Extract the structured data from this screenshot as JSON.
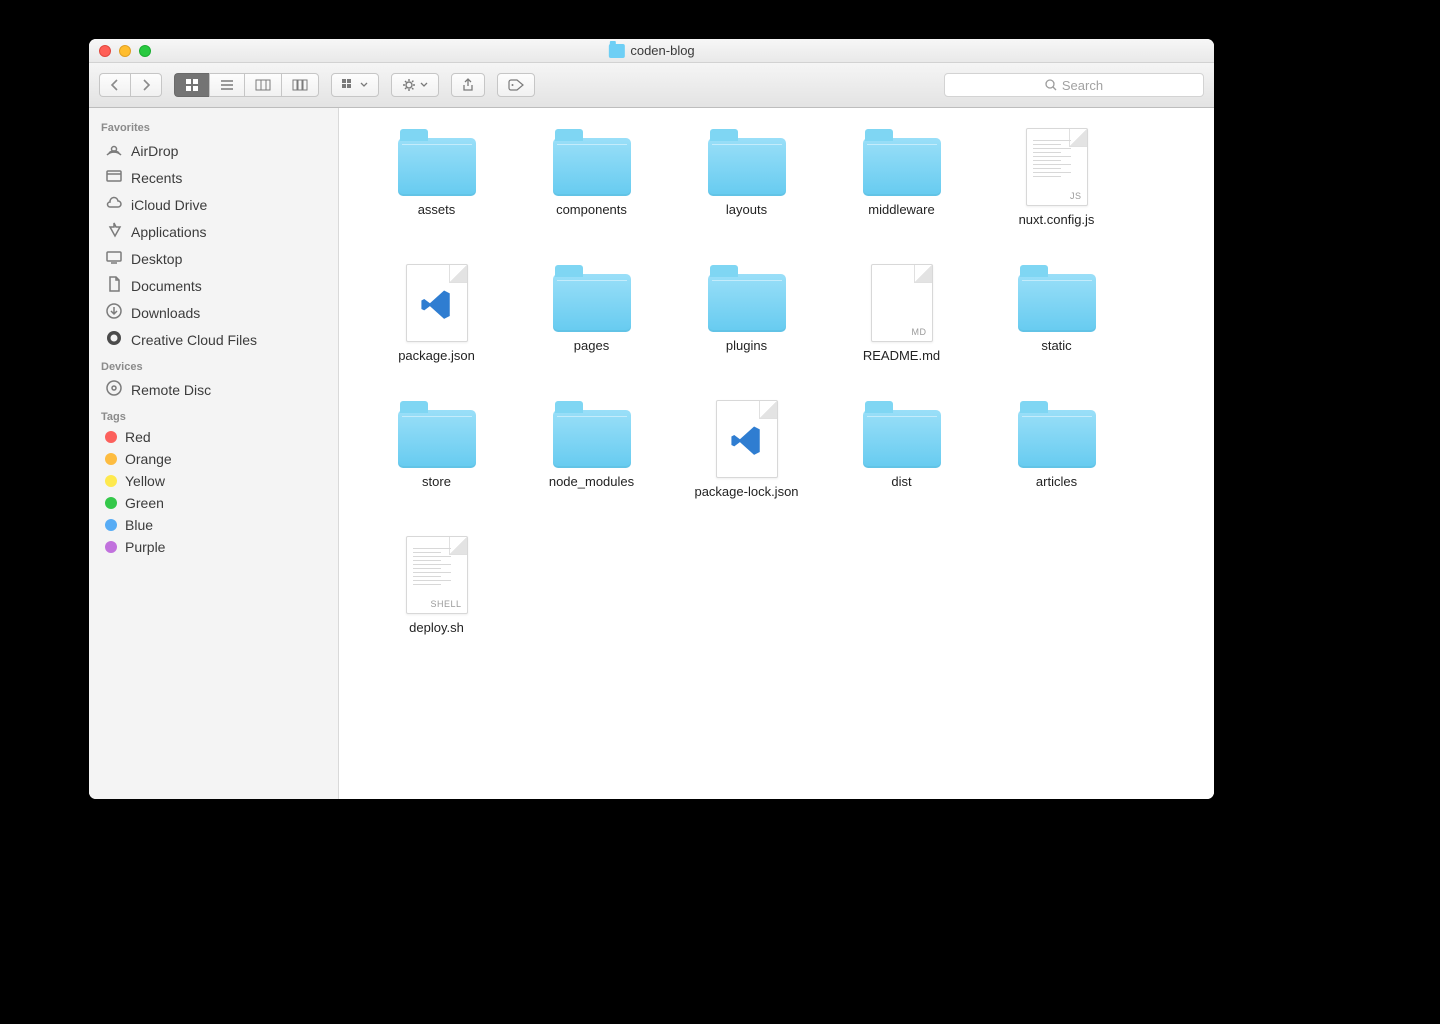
{
  "window": {
    "title": "coden-blog"
  },
  "search": {
    "placeholder": "Search"
  },
  "sidebar": {
    "groups": [
      {
        "title": "Favorites",
        "items": [
          {
            "icon": "airdrop",
            "label": "AirDrop"
          },
          {
            "icon": "recents",
            "label": "Recents"
          },
          {
            "icon": "icloud",
            "label": "iCloud Drive"
          },
          {
            "icon": "applications",
            "label": "Applications"
          },
          {
            "icon": "desktop",
            "label": "Desktop"
          },
          {
            "icon": "documents",
            "label": "Documents"
          },
          {
            "icon": "downloads",
            "label": "Downloads"
          },
          {
            "icon": "cc",
            "label": "Creative Cloud Files"
          }
        ]
      },
      {
        "title": "Devices",
        "items": [
          {
            "icon": "disc",
            "label": "Remote Disc"
          }
        ]
      },
      {
        "title": "Tags",
        "items": [
          {
            "icon": "tag",
            "color": "#fc605c",
            "label": "Red"
          },
          {
            "icon": "tag",
            "color": "#fdbc40",
            "label": "Orange"
          },
          {
            "icon": "tag",
            "color": "#fee94e",
            "label": "Yellow"
          },
          {
            "icon": "tag",
            "color": "#34c84a",
            "label": "Green"
          },
          {
            "icon": "tag",
            "color": "#57acf5",
            "label": "Blue"
          },
          {
            "icon": "tag",
            "color": "#c171dd",
            "label": "Purple"
          }
        ]
      }
    ]
  },
  "items": [
    {
      "type": "folder",
      "label": "assets"
    },
    {
      "type": "folder",
      "label": "components"
    },
    {
      "type": "folder",
      "label": "layouts"
    },
    {
      "type": "folder",
      "label": "middleware"
    },
    {
      "type": "doc",
      "badge": "JS",
      "lines": true,
      "label": "nuxt.config.js"
    },
    {
      "type": "doc",
      "vscode": true,
      "label": "package.json"
    },
    {
      "type": "folder",
      "label": "pages"
    },
    {
      "type": "folder",
      "label": "plugins"
    },
    {
      "type": "doc",
      "badge": "MD",
      "label": "README.md"
    },
    {
      "type": "folder",
      "label": "static"
    },
    {
      "type": "folder",
      "label": "store"
    },
    {
      "type": "folder",
      "label": "node_modules"
    },
    {
      "type": "doc",
      "vscode": true,
      "label": "package-lock.json"
    },
    {
      "type": "folder",
      "label": "dist"
    },
    {
      "type": "folder",
      "label": "articles"
    },
    {
      "type": "doc",
      "badge": "SHELL",
      "lines": true,
      "label": "deploy.sh"
    }
  ]
}
